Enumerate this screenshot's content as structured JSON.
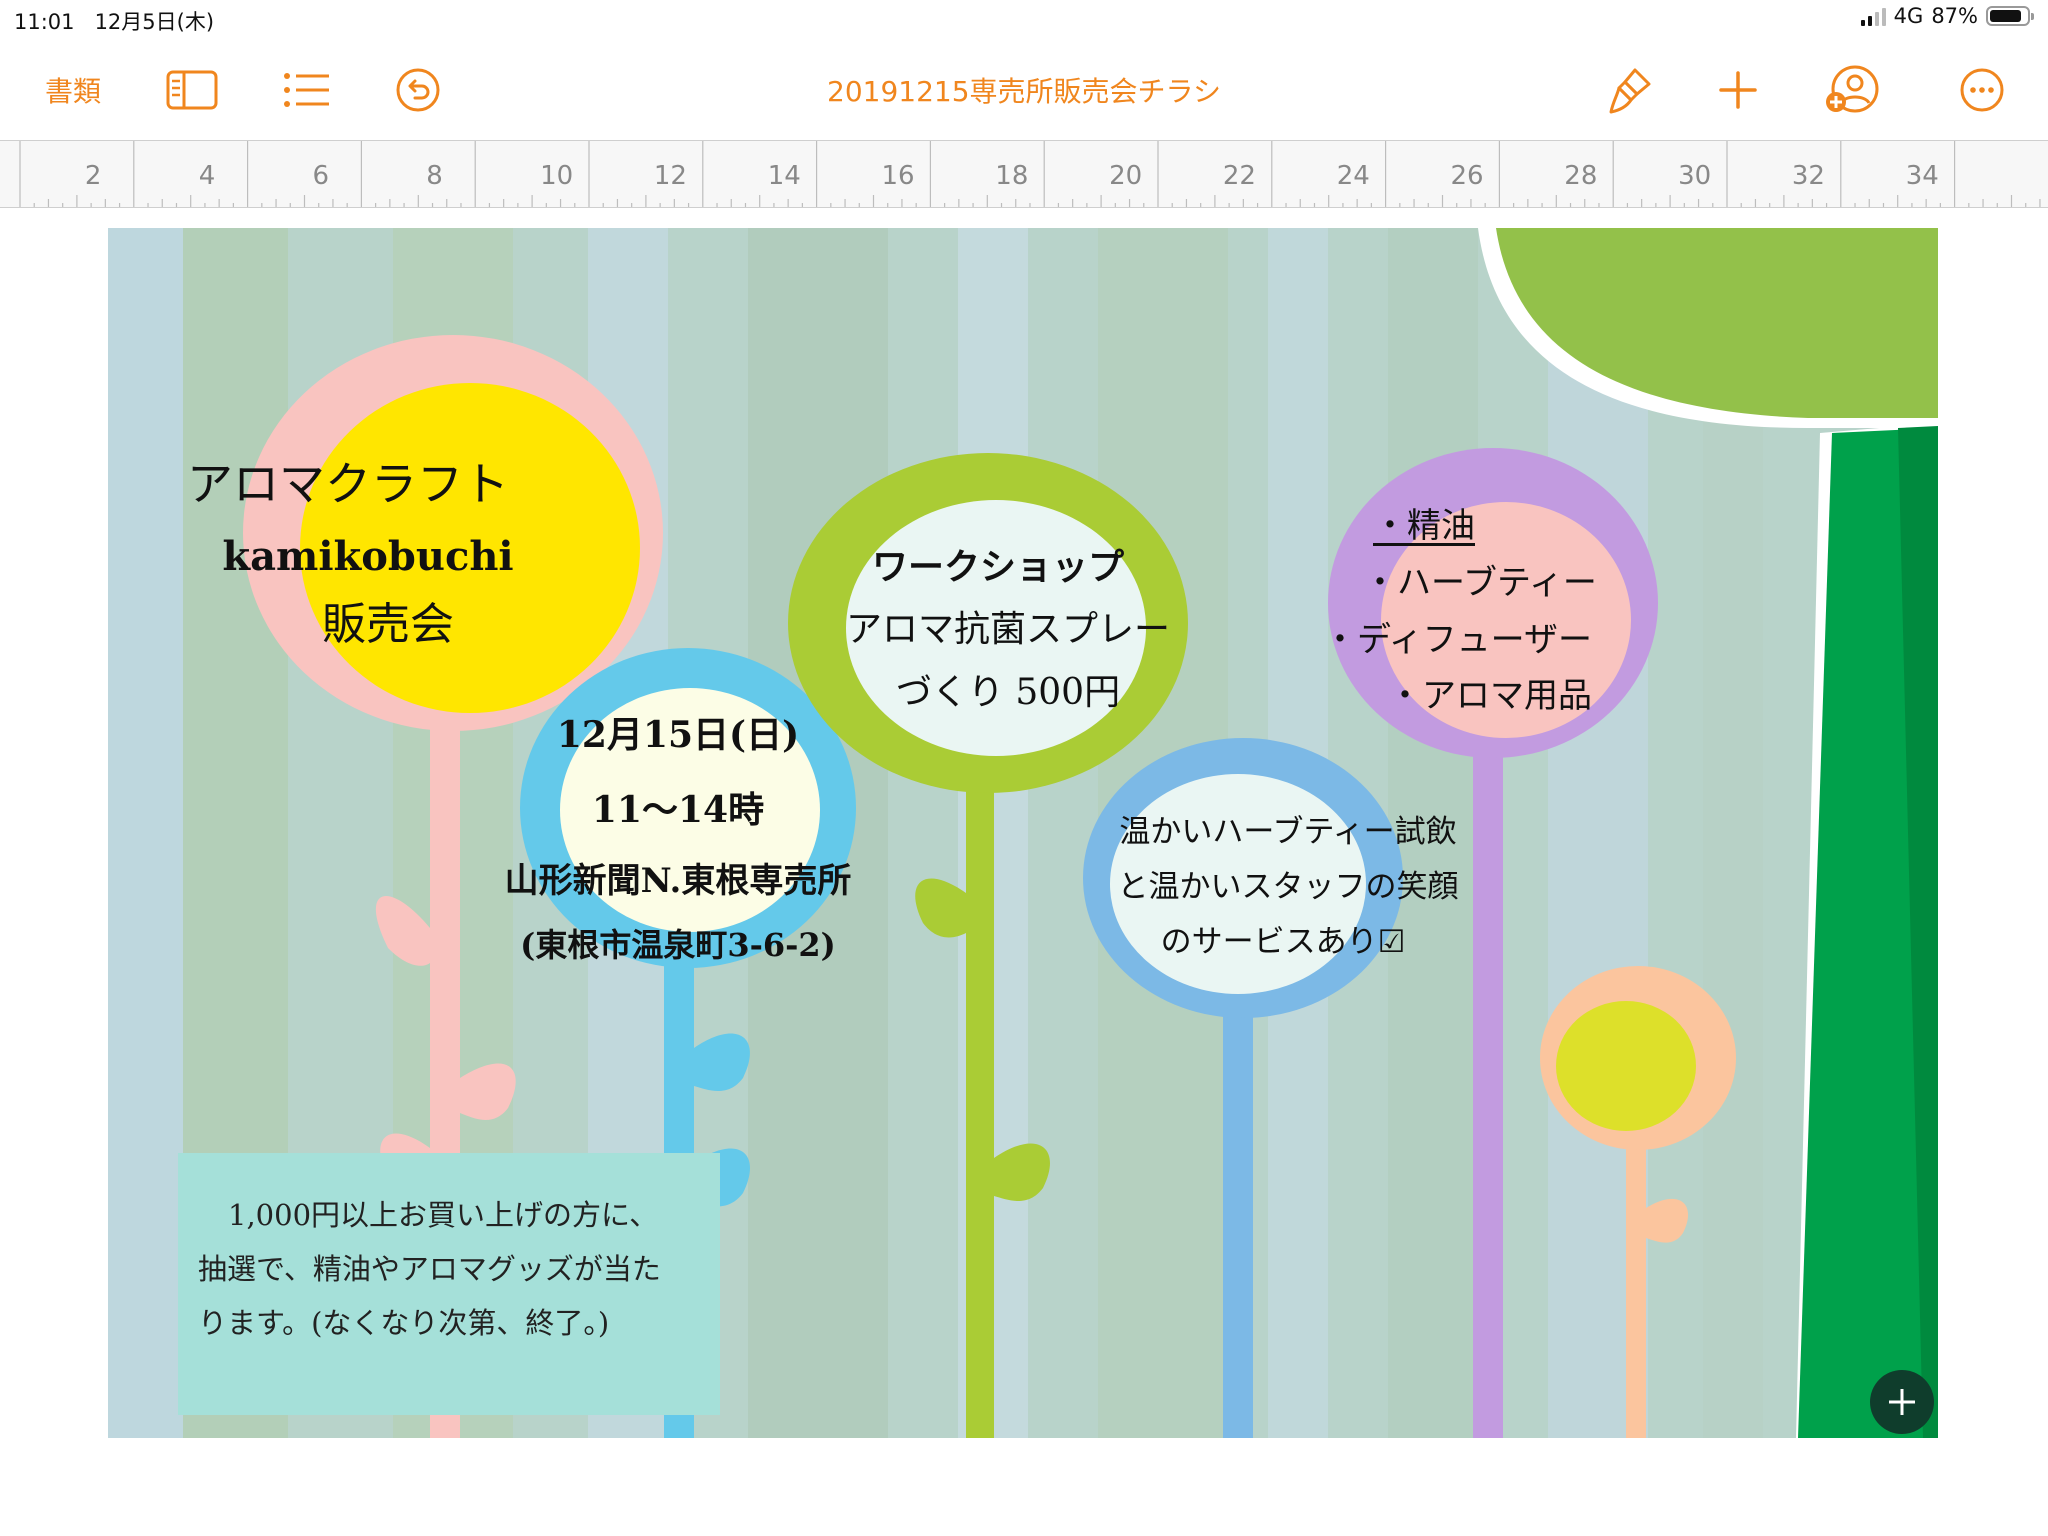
{
  "status_bar": {
    "time": "11:01",
    "date": "12月5日(木)",
    "network": "4G",
    "battery": "87%",
    "battery_level": 0.87
  },
  "toolbar": {
    "documents_label": "書類",
    "title": "20191215専売所販売会チラシ",
    "icons": {
      "sidebar": "sidebar-icon",
      "outline": "list-icon",
      "undo": "undo-icon",
      "format": "paintbrush-icon",
      "insert": "plus-icon",
      "collaborate": "add-person-icon",
      "more": "more-icon"
    },
    "accent_color": "#F0861E"
  },
  "ruler": {
    "labels": [
      "2",
      "4",
      "6",
      "8",
      "10",
      "12",
      "14",
      "16",
      "18",
      "20",
      "22",
      "24",
      "26",
      "28",
      "30",
      "32",
      "34"
    ]
  },
  "flyer": {
    "title_line1": "アロマクラフト",
    "title_line2": "kamikobuchi",
    "title_line3": "販売会",
    "date": "12月15日(日)",
    "hours": "11〜14時",
    "venue": "山形新聞N.東根専売所",
    "address": "(東根市温泉町3-6-2)",
    "workshop_line1": "ワークショップ",
    "workshop_line2": "アロマ抗菌スプレー",
    "workshop_line3": "づくり 500円",
    "products": [
      "・精油",
      "・ハーブティー",
      "・ディフューザー",
      "・アロマ用品"
    ],
    "service_line1": "温かいハーブティー試飲",
    "service_line2": "と温かいスタッフの笑顔",
    "service_line3": "のサービスあり☑",
    "lottery_line1": "1,000円以上お買い上げの方に、",
    "lottery_line2": "抽選で、精油やアロマグッズが当た",
    "lottery_line3": "ります。(なくなり次第、終了。)"
  },
  "fab_icon": "plus-icon"
}
